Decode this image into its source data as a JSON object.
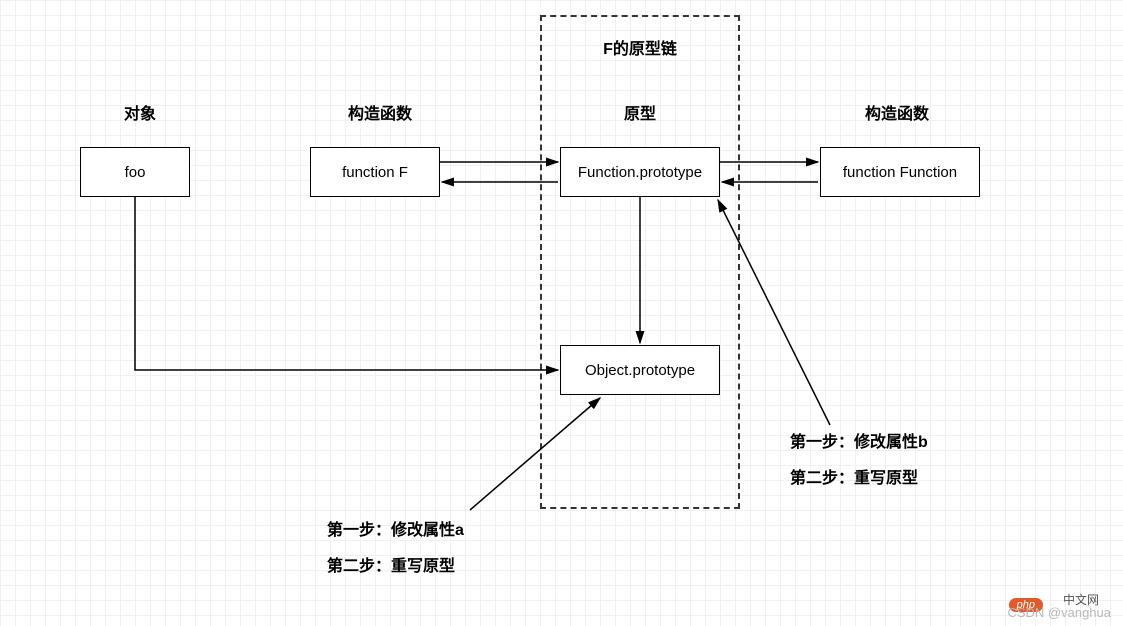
{
  "frame_title": "F的原型链",
  "headers": {
    "col_object": "对象",
    "col_constructor_left": "构造函数",
    "col_prototype": "原型",
    "col_constructor_right": "构造函数"
  },
  "boxes": {
    "foo": "foo",
    "function_F": "function F",
    "function_prototype": "Function.prototype",
    "function_Function": "function Function",
    "object_prototype": "Object.prototype"
  },
  "annotation_left": {
    "line1": "第一步：修改属性a",
    "line2": "第二步：重写原型"
  },
  "annotation_right": {
    "line1": "第一步：修改属性b",
    "line2": "第二步：重写原型"
  },
  "watermark": "CSDN @vanghua",
  "php_badge": "php",
  "cn_text": "中文网",
  "chart_data": {
    "type": "diagram",
    "title": "F的原型链",
    "nodes": [
      {
        "id": "foo",
        "label": "foo",
        "column": "对象"
      },
      {
        "id": "function_F",
        "label": "function F",
        "column": "构造函数"
      },
      {
        "id": "Function_prototype",
        "label": "Function.prototype",
        "column": "原型"
      },
      {
        "id": "function_Function",
        "label": "function Function",
        "column": "构造函数"
      },
      {
        "id": "Object_prototype",
        "label": "Object.prototype",
        "column": "原型"
      }
    ],
    "edges": [
      {
        "from": "function_F",
        "to": "Function_prototype",
        "bidirectional": true
      },
      {
        "from": "Function_prototype",
        "to": "function_Function",
        "bidirectional": true
      },
      {
        "from": "Function_prototype",
        "to": "Object_prototype",
        "bidirectional": false
      },
      {
        "from": "foo",
        "to": "Object_prototype",
        "bidirectional": false
      }
    ],
    "annotations": [
      {
        "target": "Object_prototype",
        "lines": [
          "第一步：修改属性a",
          "第二步：重写原型"
        ]
      },
      {
        "target": "Function_prototype",
        "lines": [
          "第一步：修改属性b",
          "第二步：重写原型"
        ]
      }
    ]
  }
}
